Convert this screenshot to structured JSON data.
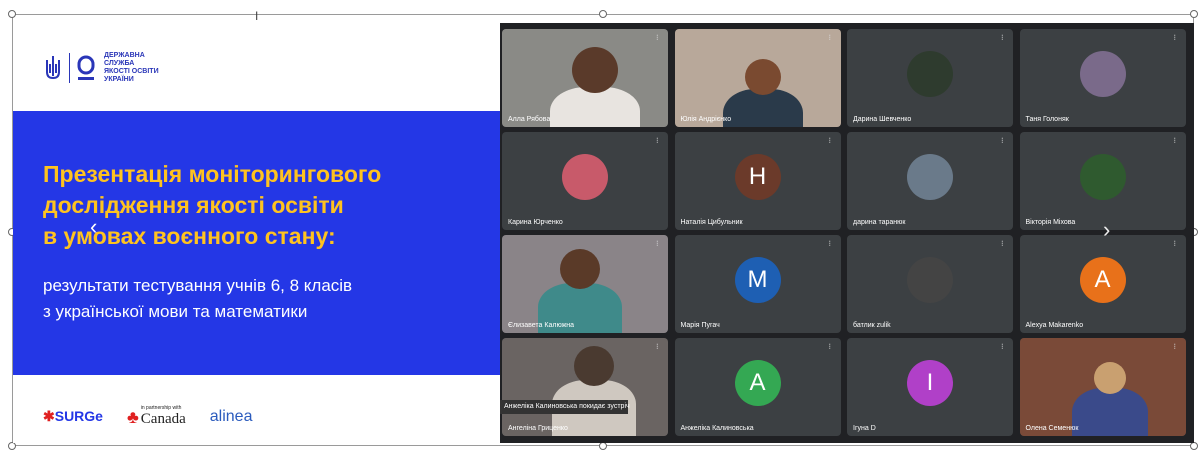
{
  "slide": {
    "logo_lines": [
      "ДЕРЖАВНА",
      "СЛУЖБА",
      "ЯКОСТІ ОСВІТИ",
      "УКРАЇНИ"
    ],
    "title_lines": [
      "Презентація моніторингового",
      "дослідження якості освіти",
      "в умовах воєнного стану:"
    ],
    "subtitle_lines": [
      "результати тестування учнів 6, 8 класів",
      "з української мови та математики"
    ],
    "footer": {
      "surge": "SURGe",
      "canada_small": "in partnership with",
      "canada": "Canada",
      "alinea": "alinea"
    }
  },
  "participants": [
    {
      "name": "Алла Рябова",
      "type": "video"
    },
    {
      "name": "Юлія Андрієнко",
      "type": "video"
    },
    {
      "name": "Дарина Шевченко",
      "type": "photo"
    },
    {
      "name": "Таня Голоняк",
      "type": "photo"
    },
    {
      "name": "Карина Юрченко",
      "type": "photo"
    },
    {
      "name": "Наталія Цибульник",
      "type": "avatar",
      "letter": "Н",
      "color": "#6b3a2a"
    },
    {
      "name": "дарина таранюк",
      "type": "photo"
    },
    {
      "name": "Вікторія Міхова",
      "type": "photo"
    },
    {
      "name": "Єлизавета Калюжна",
      "type": "video"
    },
    {
      "name": "Марія Пугач",
      "type": "avatar",
      "letter": "М",
      "color": "#1e5fb3"
    },
    {
      "name": "батлик zulik",
      "type": "photo"
    },
    {
      "name": "Alexya Makarenko",
      "type": "avatar",
      "letter": "А",
      "color": "#e8711a"
    },
    {
      "name": "Ангеліна Гриценко",
      "type": "video"
    },
    {
      "name": "Анжеліка Калиновська",
      "type": "avatar",
      "letter": "А",
      "color": "#34a853"
    },
    {
      "name": "Ігуна D",
      "type": "avatar",
      "letter": "І",
      "color": "#b040c8"
    },
    {
      "name": "Олена Семенюк",
      "type": "video"
    }
  ],
  "toast": "Анжеліка Калиновська покидає зустріч",
  "nav": {
    "prev": "‹",
    "next": "›"
  }
}
